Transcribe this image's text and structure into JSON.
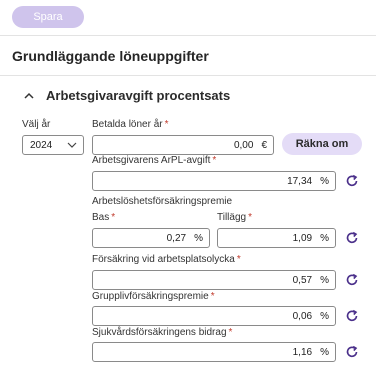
{
  "toolbar": {
    "save_label": "Spara"
  },
  "page_title": "Grundläggande löneuppgifter",
  "section": {
    "title": "Arbetsgivaravgift procentsats"
  },
  "year": {
    "label": "Välj år",
    "value": "2024"
  },
  "paid_salaries": {
    "label": "Betalda löner år",
    "value": "0,00",
    "unit": "€"
  },
  "recalc_label": "Räkna om",
  "arpl": {
    "label": "Arbetsgivarens ArPL-avgift",
    "value": "17,34",
    "unit": "%"
  },
  "unemployment": {
    "label": "Arbetslöshetsförsäkringspremie",
    "bas": {
      "label": "Bas",
      "value": "0,27",
      "unit": "%"
    },
    "tillagg": {
      "label": "Tillägg",
      "value": "1,09",
      "unit": "%"
    }
  },
  "accident": {
    "label": "Försäkring vid arbetsplatsolycka",
    "value": "0,57",
    "unit": "%"
  },
  "group_life": {
    "label": "Grupplivförsäkringspremie",
    "value": "0,06",
    "unit": "%"
  },
  "health": {
    "label": "Sjukvårdsförsäkringens bidrag",
    "value": "1,16",
    "unit": "%"
  },
  "required_mark": "*",
  "colors": {
    "accent": "#cfc4ec",
    "accent_light": "#e4dcf7",
    "required": "#c0392b",
    "icon": "#4a2f8a"
  }
}
